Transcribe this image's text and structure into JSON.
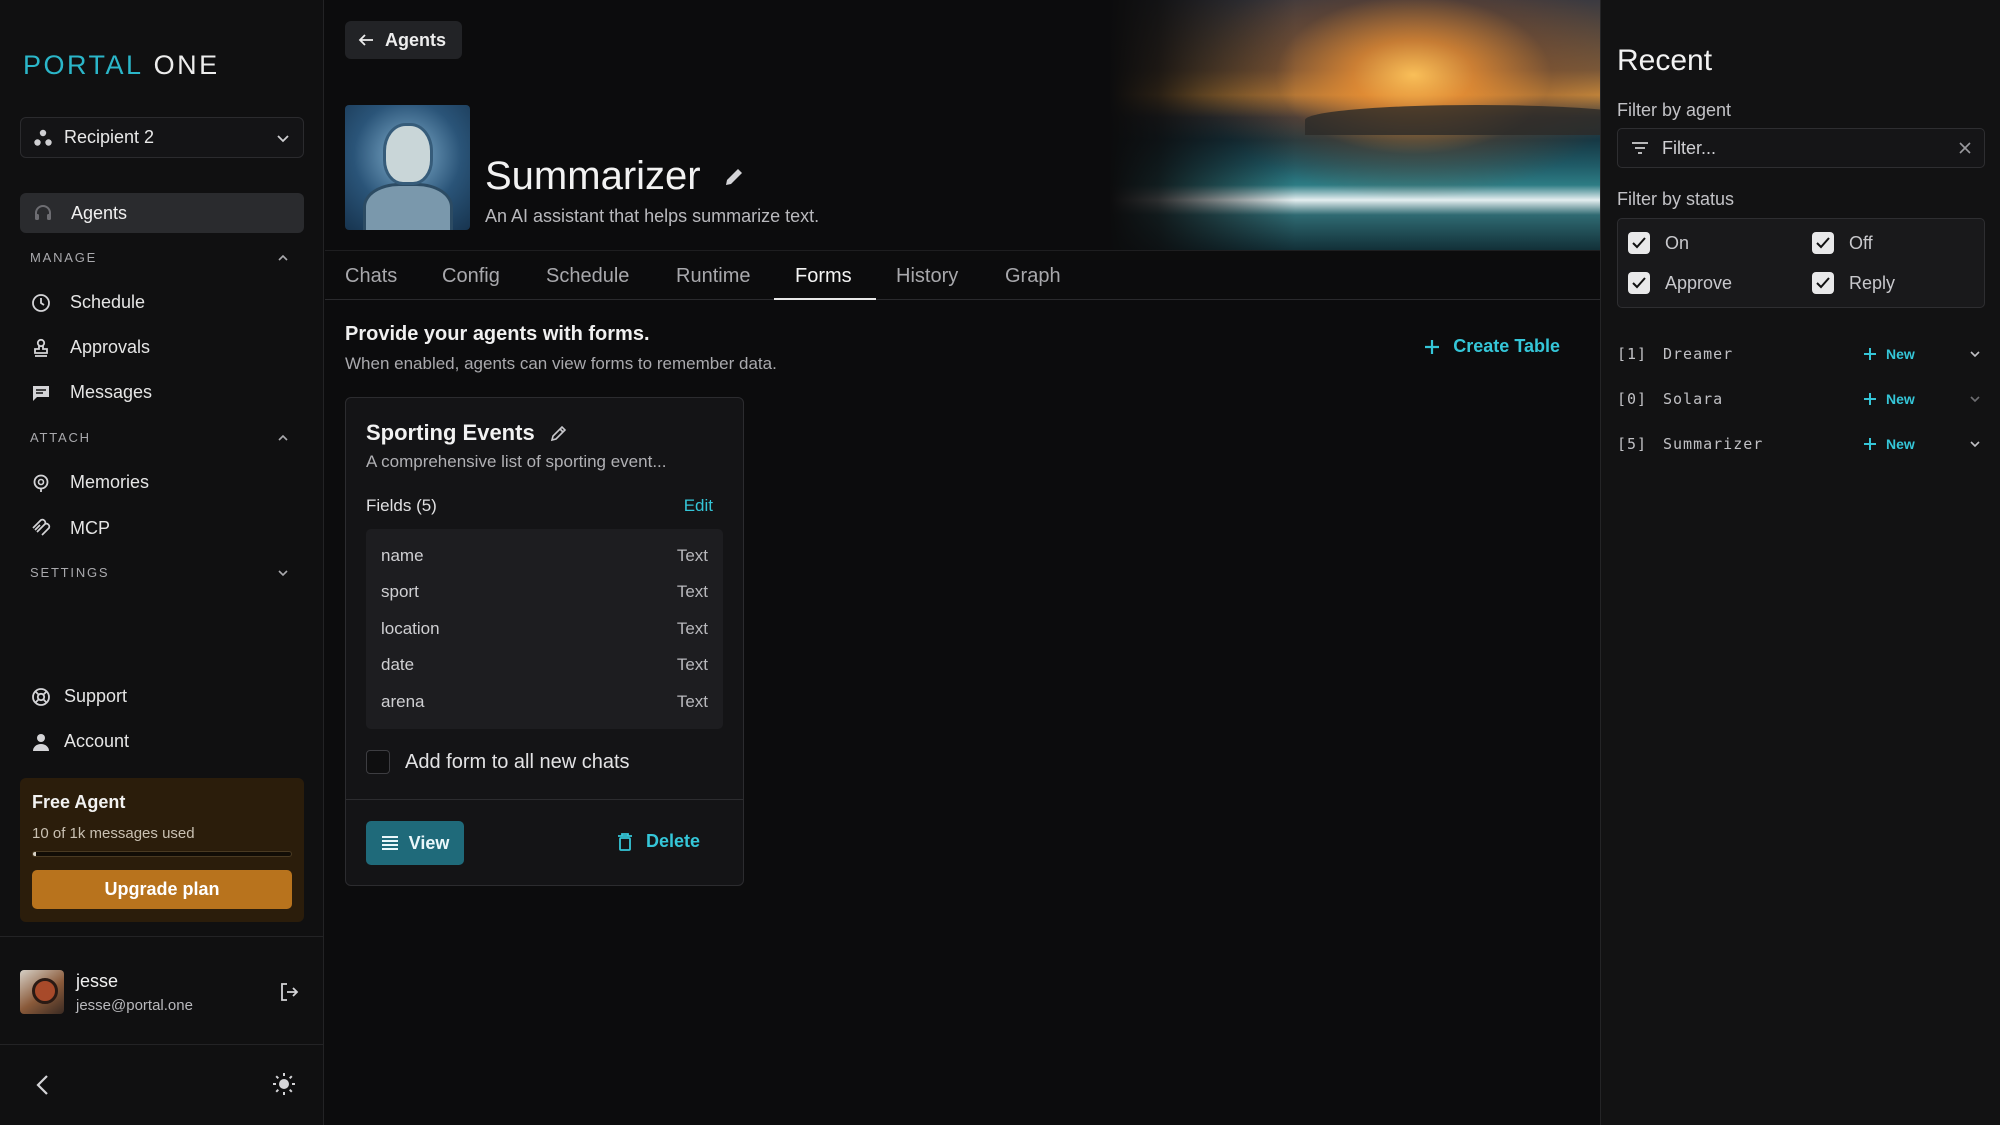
{
  "app": {
    "logo_part1": "PORTAL",
    "logo_part2": "ONE"
  },
  "sidebar": {
    "recipient": "Recipient 2",
    "active_item": "Agents",
    "sections": {
      "manage": "MANAGE",
      "attach": "ATTACH",
      "settings": "SETTINGS"
    },
    "manage_items": [
      "Schedule",
      "Approvals",
      "Messages"
    ],
    "attach_items": [
      "Memories",
      "MCP"
    ],
    "support": "Support",
    "account": "Account",
    "plan": {
      "title": "Free Agent",
      "usage": "10 of 1k messages used",
      "usage_fraction": 0.01,
      "button": "Upgrade plan"
    },
    "user": {
      "name": "jesse",
      "email": "jesse@portal.one"
    }
  },
  "header": {
    "back_label": "Agents",
    "agent_name": "Summarizer",
    "agent_description": "An AI assistant that helps summarize text."
  },
  "tabs": [
    "Chats",
    "Config",
    "Schedule",
    "Runtime",
    "Forms",
    "History",
    "Graph"
  ],
  "active_tab": "Forms",
  "forms": {
    "title": "Provide your agents with forms.",
    "subtitle": "When enabled, agents can view forms to remember data.",
    "create_label": "Create Table",
    "card": {
      "title": "Sporting Events",
      "description": "A comprehensive list of sporting event...",
      "fields_label": "Fields (5)",
      "edit_label": "Edit",
      "fields": [
        {
          "name": "name",
          "type": "Text"
        },
        {
          "name": "sport",
          "type": "Text"
        },
        {
          "name": "location",
          "type": "Text"
        },
        {
          "name": "date",
          "type": "Text"
        },
        {
          "name": "arena",
          "type": "Text"
        }
      ],
      "add_to_chats": "Add form to all new chats",
      "add_to_chats_checked": false,
      "view_label": "View",
      "delete_label": "Delete"
    }
  },
  "recent": {
    "title": "Recent",
    "filter_agent_label": "Filter by agent",
    "filter_placeholder": "Filter...",
    "filter_status_label": "Filter by status",
    "statuses": [
      {
        "label": "On",
        "checked": true
      },
      {
        "label": "Off",
        "checked": true
      },
      {
        "label": "Approve",
        "checked": true
      },
      {
        "label": "Reply",
        "checked": true
      }
    ],
    "agents": [
      {
        "index": "[1]",
        "name": "Dreamer",
        "action": "New"
      },
      {
        "index": "[0]",
        "name": "Solara",
        "action": "New"
      },
      {
        "index": "[5]",
        "name": "Summarizer",
        "action": "New"
      }
    ]
  },
  "colors": {
    "accent": "#35c6d8",
    "upgrade": "#b8731d",
    "view_button": "#1f6a7a"
  }
}
